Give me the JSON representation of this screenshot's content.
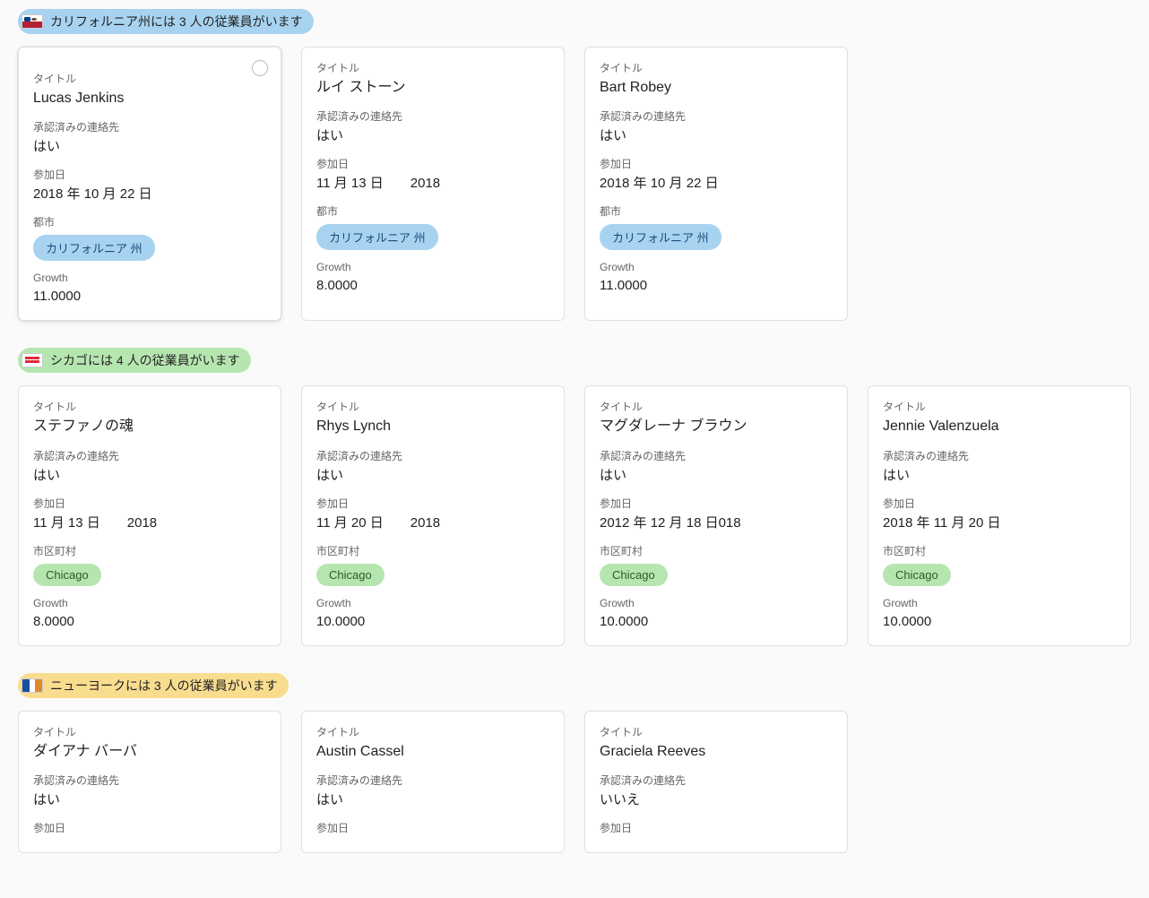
{
  "labels": {
    "title": "タイトル",
    "approved": "承認済みの連絡先",
    "joined": "参加日",
    "city": "都市",
    "city2": "市区町村",
    "growth": "Growth"
  },
  "groups": [
    {
      "header": "カリフォルニア州には 3 人の従業員がいます",
      "color": "blue",
      "flag": "ca",
      "city_label_key": "city",
      "cards": [
        {
          "selected": true,
          "title": "Lucas Jenkins",
          "approved": "はい",
          "joined": "2018 年 10 月 22 日",
          "city": "カリフォルニア 州",
          "growth": "11.0000"
        },
        {
          "selected": false,
          "title": "ルイ ストーン",
          "approved": "はい",
          "joined": "11 月 13 日　　2018",
          "city": "カリフォルニア 州",
          "growth": "8.0000"
        },
        {
          "selected": false,
          "title": "Bart Robey",
          "approved": "はい",
          "joined": "2018 年 10 月 22 日",
          "city": "カリフォルニア 州",
          "growth": "11.0000"
        }
      ]
    },
    {
      "header": "シカゴには 4 人の従業員がいます",
      "color": "green",
      "flag": "chi",
      "city_label_key": "city2",
      "cards": [
        {
          "selected": false,
          "title": "ステファノの魂",
          "approved": "はい",
          "joined": "11 月 13 日　　2018",
          "city": "Chicago",
          "growth": "8.0000"
        },
        {
          "selected": false,
          "title": "Rhys Lynch",
          "approved": "はい",
          "joined": "11 月 20 日　　2018",
          "city": "Chicago",
          "growth": "10.0000"
        },
        {
          "selected": false,
          "title": "マグダレーナ ブラウン",
          "approved": "はい",
          "joined": "2012 年 12 月 18 日018",
          "city": "Chicago",
          "growth": "10.0000"
        },
        {
          "selected": false,
          "title": "Jennie Valenzuela",
          "approved": "はい",
          "joined": "2018 年 11 月 20 日",
          "city": "Chicago",
          "growth": "10.0000"
        }
      ]
    },
    {
      "header": "ニューヨークには 3 人の従業員がいます",
      "color": "yellow",
      "flag": "ny",
      "city_label_key": "city2",
      "cards": [
        {
          "selected": false,
          "title": "ダイアナ バーバ",
          "approved": "はい",
          "joined": "",
          "city": "",
          "growth": ""
        },
        {
          "selected": false,
          "title": "Austin Cassel",
          "approved": "はい",
          "joined": "",
          "city": "",
          "growth": ""
        },
        {
          "selected": false,
          "title": "Graciela Reeves",
          "approved": "いいえ",
          "joined": "",
          "city": "",
          "growth": ""
        }
      ]
    }
  ]
}
